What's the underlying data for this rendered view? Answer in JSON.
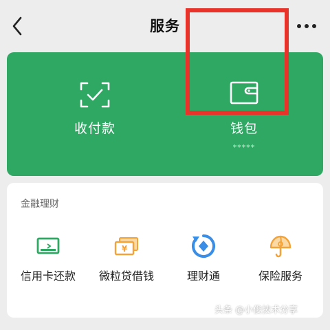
{
  "nav": {
    "title": "服务",
    "back_icon": "chevron-left-icon",
    "more_icon": "more-dots-icon"
  },
  "payment_card": {
    "background": "#2fa863",
    "items": [
      {
        "label": "收付款",
        "icon": "scan-check-icon"
      },
      {
        "label": "钱包",
        "sub": "*****",
        "icon": "wallet-icon"
      }
    ],
    "highlight_color": "#e8332a"
  },
  "finance": {
    "title": "金融理财",
    "items": [
      {
        "label": "信用卡还款",
        "icon": "credit-card-icon",
        "color": "#2fa863"
      },
      {
        "label": "微粒贷借钱",
        "icon": "loan-bills-icon",
        "color": "#f2a33a"
      },
      {
        "label": "理财通",
        "icon": "licaitong-icon",
        "color": "#3b8ee6"
      },
      {
        "label": "保险服务",
        "icon": "insurance-umbrella-icon",
        "color": "#f2a33a"
      }
    ]
  },
  "watermark": "头条 @小俊技术分享"
}
